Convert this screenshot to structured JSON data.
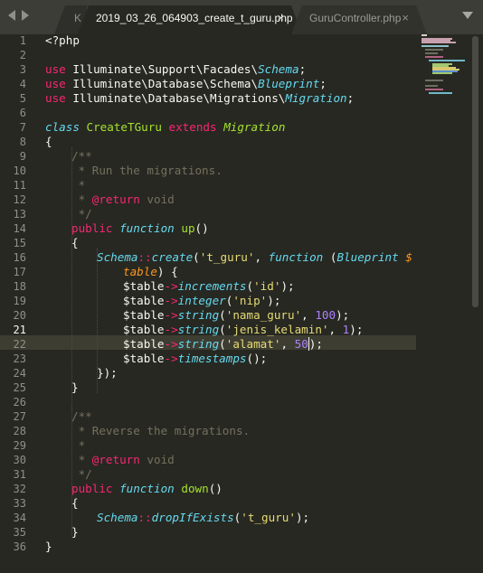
{
  "tabs": [
    {
      "label": "K",
      "state": "partial"
    },
    {
      "label": "2019_03_26_064903_create_t_guru.php",
      "state": "active",
      "close": "×"
    },
    {
      "label": "GuruController.php",
      "state": "inactive",
      "close": "×"
    }
  ],
  "icons": {
    "nav_left": "triangle-left-icon",
    "nav_right": "triangle-right-icon",
    "tab_menu": "chevron-down-icon"
  },
  "editor": {
    "current_line": 21,
    "colors": {
      "background": "#272822",
      "keyword": "#f92672",
      "function": "#a6e22e",
      "string": "#e6db74",
      "number": "#ae81ff",
      "comment": "#75715e",
      "storage": "#66d9ef"
    },
    "lines": [
      {
        "n": "1"
      },
      {
        "n": "2"
      },
      {
        "n": "3"
      },
      {
        "n": "4"
      },
      {
        "n": "5"
      },
      {
        "n": "6"
      },
      {
        "n": "7"
      },
      {
        "n": "8"
      },
      {
        "n": "9"
      },
      {
        "n": "10"
      },
      {
        "n": "11"
      },
      {
        "n": "12"
      },
      {
        "n": "13"
      },
      {
        "n": "14"
      },
      {
        "n": "15"
      },
      {
        "n": "16"
      },
      {
        "n": "17"
      },
      {
        "n": "18"
      },
      {
        "n": "19"
      },
      {
        "n": "20"
      },
      {
        "n": "21"
      },
      {
        "n": "22"
      },
      {
        "n": "23"
      },
      {
        "n": "24"
      },
      {
        "n": "25"
      },
      {
        "n": "26"
      },
      {
        "n": "27"
      },
      {
        "n": "28"
      },
      {
        "n": "29"
      },
      {
        "n": "30"
      },
      {
        "n": "31"
      },
      {
        "n": "32"
      },
      {
        "n": "33"
      },
      {
        "n": "34"
      },
      {
        "n": "35"
      },
      {
        "n": "36"
      }
    ],
    "code": {
      "l1": "<?php",
      "use": "use",
      "l3_ns": "Illuminate\\Support\\Facades\\",
      "l3_cls": "Schema",
      "l4_ns": "Illuminate\\Database\\Schema\\",
      "l4_cls": "Blueprint",
      "l5_ns": "Illuminate\\Database\\Migrations\\",
      "l5_cls": "Migration",
      "semi": ";",
      "class_kw": "class",
      "class_name": "CreateTGuru",
      "extends_kw": "extends",
      "parent_cls": "Migration",
      "open_brace": "{",
      "close_brace": "}",
      "doc_open": "/**",
      "doc_run": " * Run the migrations.",
      "doc_star": " *",
      "doc_return_pre": " * ",
      "doc_return_tag": "@return",
      "doc_return_type": " void",
      "doc_close": " */",
      "public_kw": "public",
      "function_kw": "function",
      "up_name": "up",
      "parens": "()",
      "schema_cls": "Schema",
      "dcolon": "::",
      "create_fn": "create",
      "paren_open": "(",
      "t_guru_str": "'t_guru'",
      "comma_sp": ", ",
      "blueprint_cls": "Blueprint",
      "dollar": "$",
      "table_param": "table",
      "paren_brace": ") {",
      "table_var": "$table",
      "arrow": "->",
      "increments_fn": "increments",
      "id_str": "'id'",
      "close_semi": ");",
      "integer_fn": "integer",
      "nip_str": "'nip'",
      "string_fn": "string",
      "nama_guru_str": "'nama_guru'",
      "num_100": "100",
      "jenis_kelamin_str": "'jenis_kelamin'",
      "num_1": "1",
      "alamat_str": "'alamat'",
      "num_50": "50",
      "timestamps_fn": "timestamps",
      "close_fn": "});",
      "doc_reverse": " * Reverse the migrations.",
      "down_name": "down",
      "drop_fn": "dropIfExists"
    }
  }
}
